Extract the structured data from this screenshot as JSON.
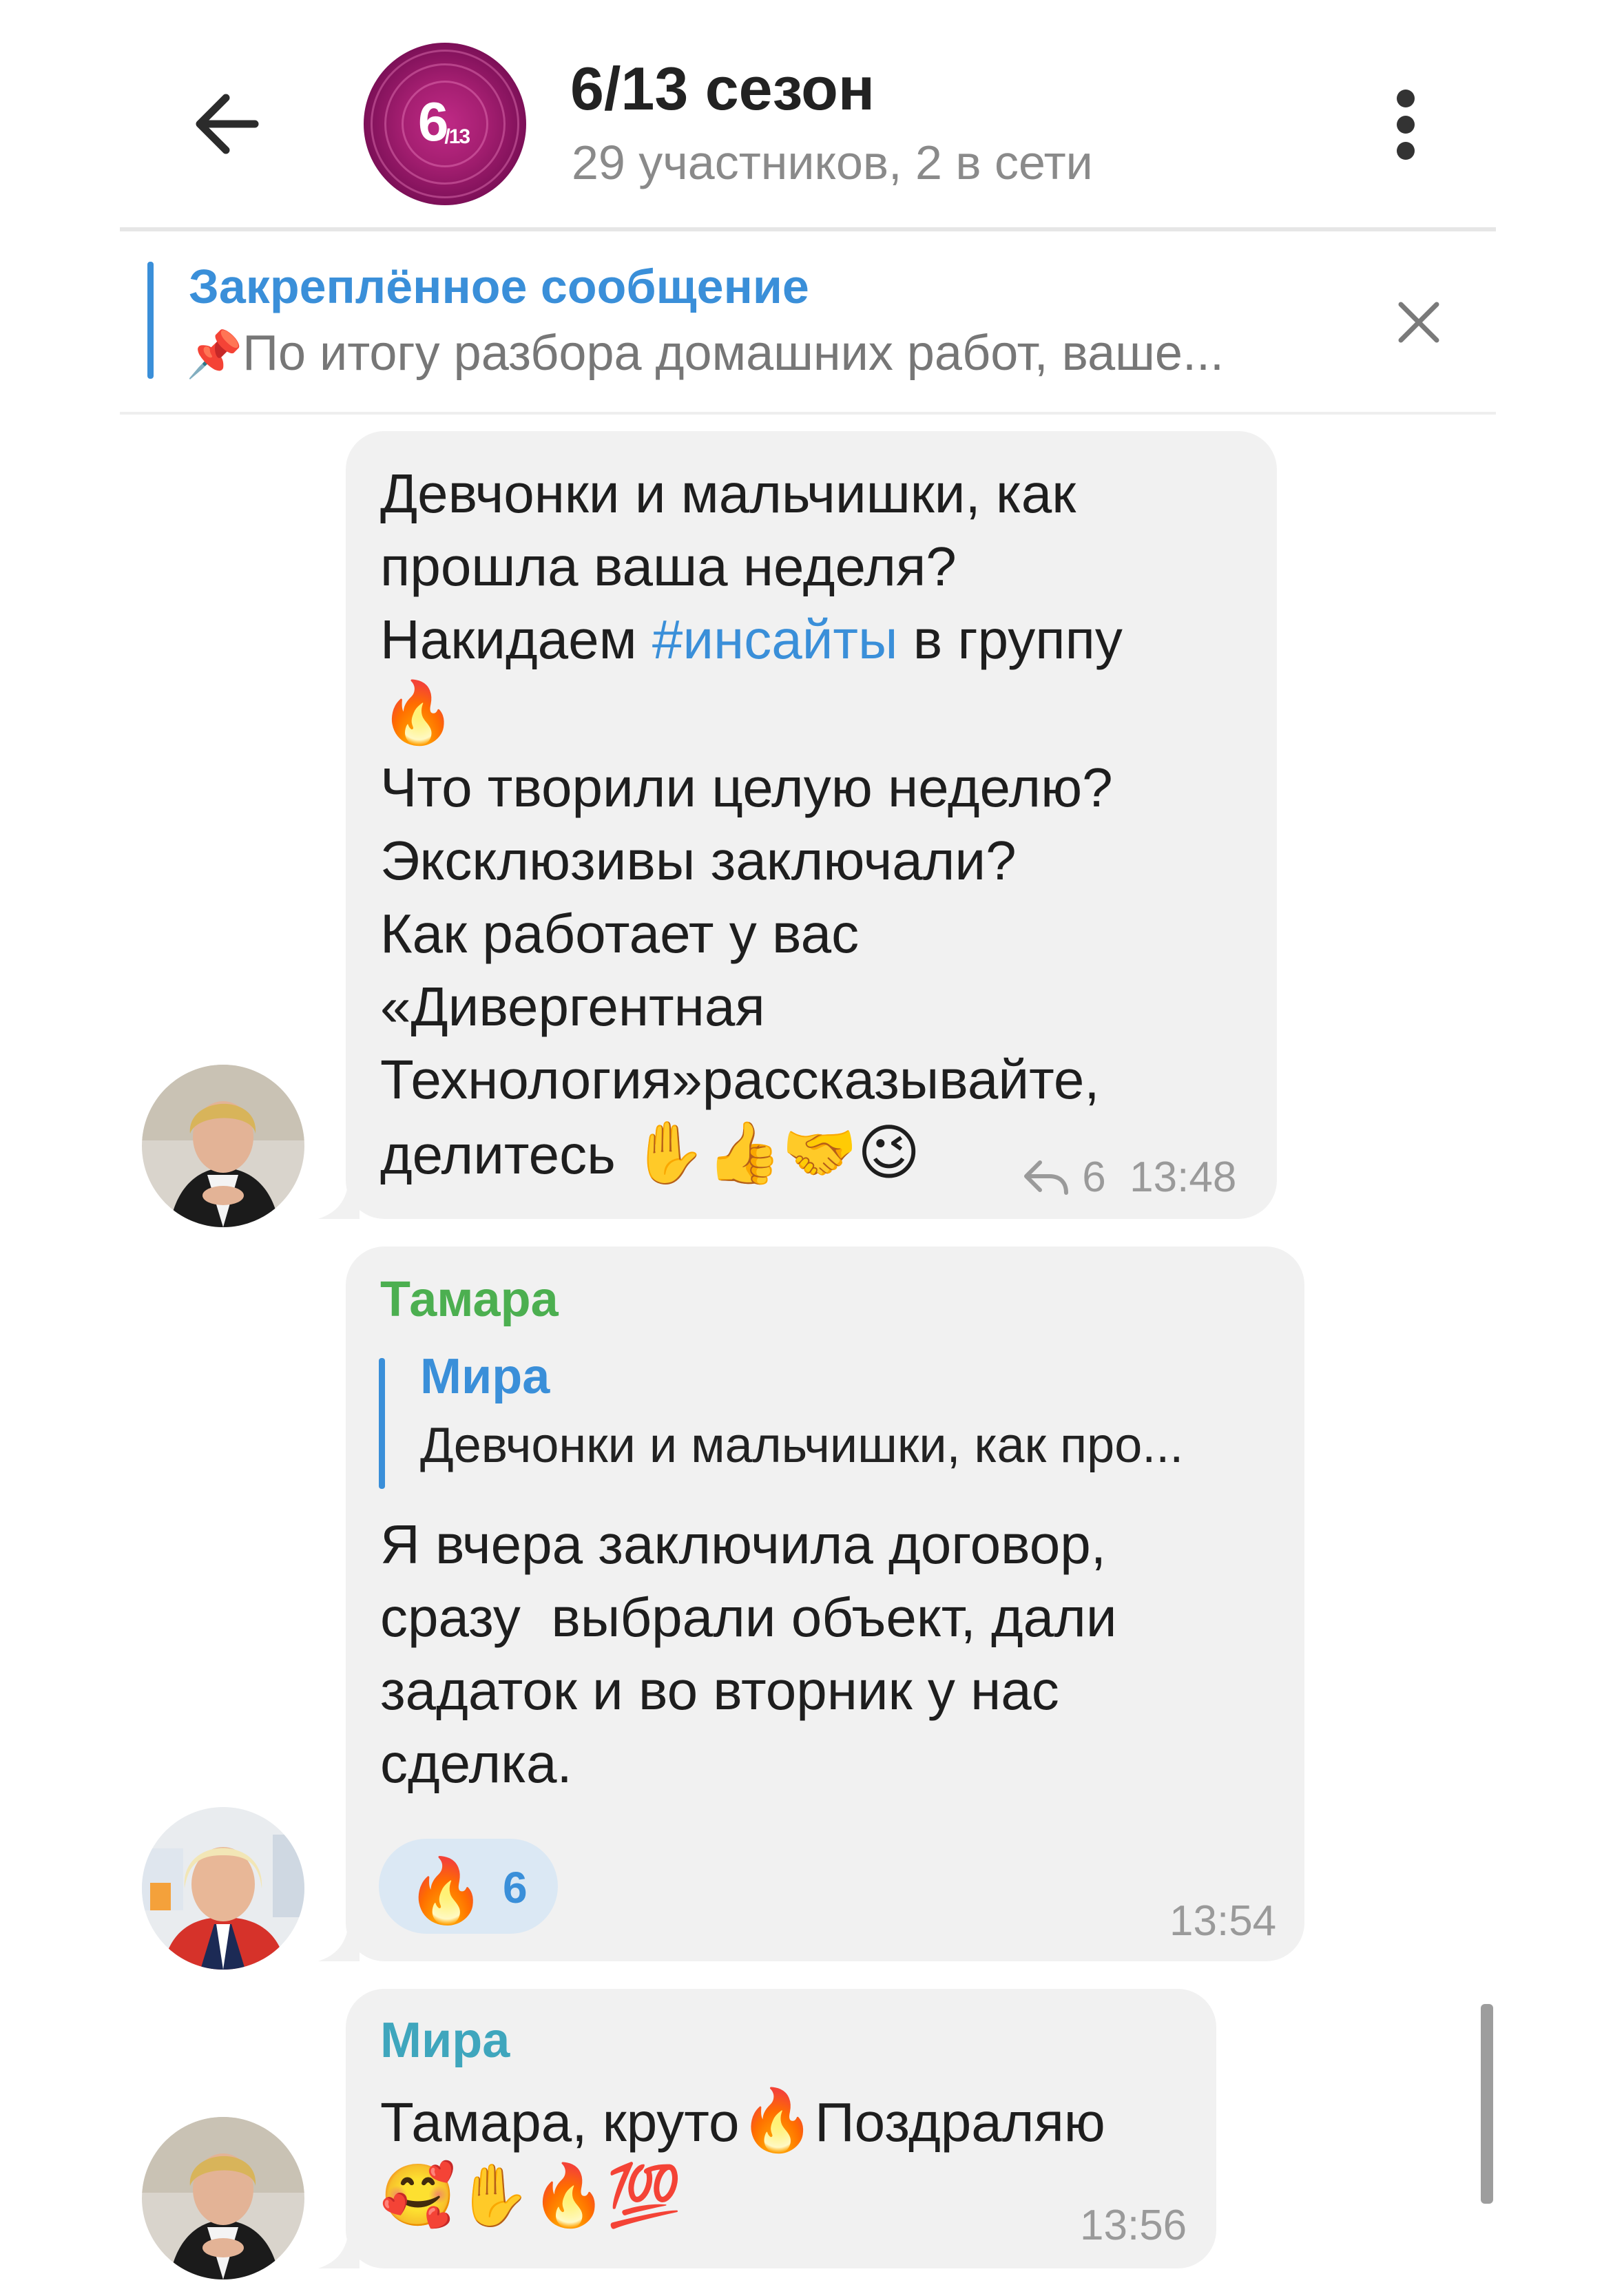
{
  "header": {
    "avatar_text": "6",
    "avatar_sub": "/13",
    "title": "6/13 сезон",
    "subtitle": "29 участников, 2 в сети"
  },
  "pinned": {
    "title": "Закреплённое сообщение",
    "icon": "📌",
    "preview": "По итогу разбора домашних работ, ваше..."
  },
  "messages": [
    {
      "lines": {
        "l1": "Девчонки и мальчишки, как",
        "l2": "прошла ваша неделя?",
        "l3a": "Накидаем ",
        "l3b": "#инсайты",
        "l3c": " в группу",
        "l4": "🔥",
        "l5": "Что творили целую неделю?",
        "l6": "Эксклюзивы заключали?",
        "l7": "Как работает у вас",
        "l8": "«Дивергентная",
        "l9": "Технология»рассказывайте,",
        "l10a": "делитесь ",
        "l10b": "✋👍🤝😉"
      },
      "reply_count": "6",
      "time": "13:48"
    },
    {
      "sender": "Тамара",
      "sender_color": "#4caf50",
      "reply_to": {
        "name": "Мира",
        "text": "Девчонки и мальчишки, как про..."
      },
      "lines": {
        "l1": "Я вчера заключила договор,",
        "l2": "сразу  выбрали объект, дали",
        "l3": "задаток и во вторник у нас",
        "l4": "сделка."
      },
      "reaction": {
        "emoji": "🔥",
        "count": "6"
      },
      "time": "13:54"
    },
    {
      "sender": "Мира",
      "sender_color": "#3fa6bd",
      "lines": {
        "l1a": "Тамара, круто",
        "l1b": "🔥",
        "l1c": "Поздраляю",
        "l2": "🥰✋🔥💯"
      },
      "time": "13:56"
    }
  ],
  "colors": {
    "accent": "#3a8fd9",
    "bubble": "#f1f1f1",
    "avatar_purple": "#a31e70"
  },
  "icons": {
    "back": "arrow-left-icon",
    "menu": "more-vertical-icon",
    "close": "close-icon",
    "pin": "pushpin-icon",
    "reply": "reply-arrow-icon"
  }
}
